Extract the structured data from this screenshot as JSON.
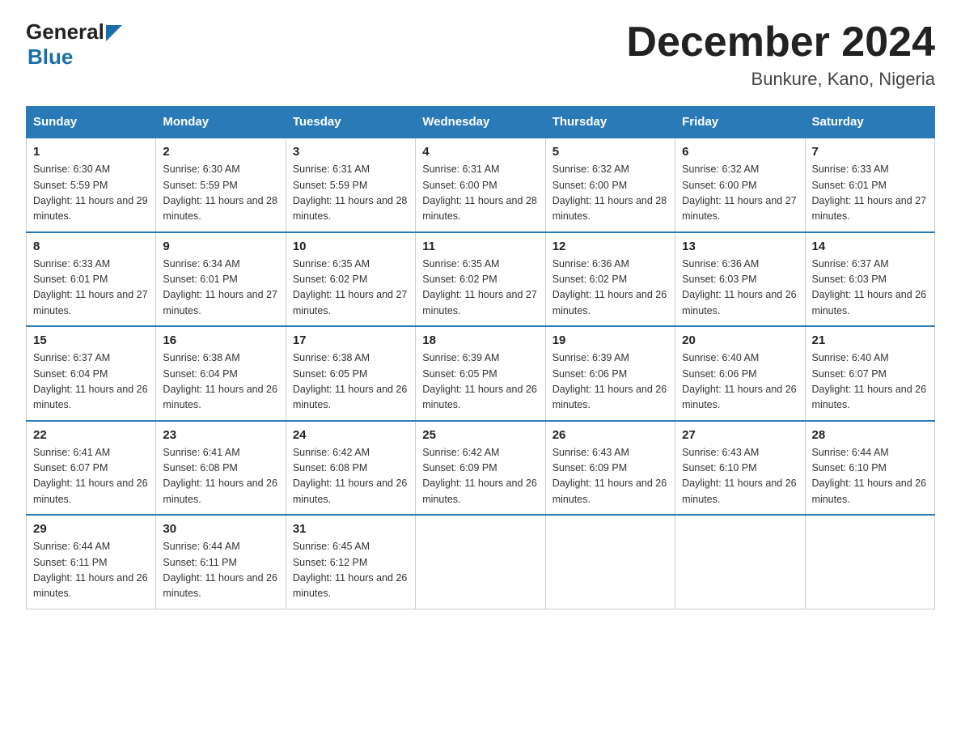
{
  "logo": {
    "text_general": "General",
    "text_blue": "Blue"
  },
  "header": {
    "month_title": "December 2024",
    "location": "Bunkure, Kano, Nigeria"
  },
  "weekdays": [
    "Sunday",
    "Monday",
    "Tuesday",
    "Wednesday",
    "Thursday",
    "Friday",
    "Saturday"
  ],
  "weeks": [
    [
      {
        "num": "1",
        "sunrise": "6:30 AM",
        "sunset": "5:59 PM",
        "daylight": "11 hours and 29 minutes."
      },
      {
        "num": "2",
        "sunrise": "6:30 AM",
        "sunset": "5:59 PM",
        "daylight": "11 hours and 28 minutes."
      },
      {
        "num": "3",
        "sunrise": "6:31 AM",
        "sunset": "5:59 PM",
        "daylight": "11 hours and 28 minutes."
      },
      {
        "num": "4",
        "sunrise": "6:31 AM",
        "sunset": "6:00 PM",
        "daylight": "11 hours and 28 minutes."
      },
      {
        "num": "5",
        "sunrise": "6:32 AM",
        "sunset": "6:00 PM",
        "daylight": "11 hours and 28 minutes."
      },
      {
        "num": "6",
        "sunrise": "6:32 AM",
        "sunset": "6:00 PM",
        "daylight": "11 hours and 27 minutes."
      },
      {
        "num": "7",
        "sunrise": "6:33 AM",
        "sunset": "6:01 PM",
        "daylight": "11 hours and 27 minutes."
      }
    ],
    [
      {
        "num": "8",
        "sunrise": "6:33 AM",
        "sunset": "6:01 PM",
        "daylight": "11 hours and 27 minutes."
      },
      {
        "num": "9",
        "sunrise": "6:34 AM",
        "sunset": "6:01 PM",
        "daylight": "11 hours and 27 minutes."
      },
      {
        "num": "10",
        "sunrise": "6:35 AM",
        "sunset": "6:02 PM",
        "daylight": "11 hours and 27 minutes."
      },
      {
        "num": "11",
        "sunrise": "6:35 AM",
        "sunset": "6:02 PM",
        "daylight": "11 hours and 27 minutes."
      },
      {
        "num": "12",
        "sunrise": "6:36 AM",
        "sunset": "6:02 PM",
        "daylight": "11 hours and 26 minutes."
      },
      {
        "num": "13",
        "sunrise": "6:36 AM",
        "sunset": "6:03 PM",
        "daylight": "11 hours and 26 minutes."
      },
      {
        "num": "14",
        "sunrise": "6:37 AM",
        "sunset": "6:03 PM",
        "daylight": "11 hours and 26 minutes."
      }
    ],
    [
      {
        "num": "15",
        "sunrise": "6:37 AM",
        "sunset": "6:04 PM",
        "daylight": "11 hours and 26 minutes."
      },
      {
        "num": "16",
        "sunrise": "6:38 AM",
        "sunset": "6:04 PM",
        "daylight": "11 hours and 26 minutes."
      },
      {
        "num": "17",
        "sunrise": "6:38 AM",
        "sunset": "6:05 PM",
        "daylight": "11 hours and 26 minutes."
      },
      {
        "num": "18",
        "sunrise": "6:39 AM",
        "sunset": "6:05 PM",
        "daylight": "11 hours and 26 minutes."
      },
      {
        "num": "19",
        "sunrise": "6:39 AM",
        "sunset": "6:06 PM",
        "daylight": "11 hours and 26 minutes."
      },
      {
        "num": "20",
        "sunrise": "6:40 AM",
        "sunset": "6:06 PM",
        "daylight": "11 hours and 26 minutes."
      },
      {
        "num": "21",
        "sunrise": "6:40 AM",
        "sunset": "6:07 PM",
        "daylight": "11 hours and 26 minutes."
      }
    ],
    [
      {
        "num": "22",
        "sunrise": "6:41 AM",
        "sunset": "6:07 PM",
        "daylight": "11 hours and 26 minutes."
      },
      {
        "num": "23",
        "sunrise": "6:41 AM",
        "sunset": "6:08 PM",
        "daylight": "11 hours and 26 minutes."
      },
      {
        "num": "24",
        "sunrise": "6:42 AM",
        "sunset": "6:08 PM",
        "daylight": "11 hours and 26 minutes."
      },
      {
        "num": "25",
        "sunrise": "6:42 AM",
        "sunset": "6:09 PM",
        "daylight": "11 hours and 26 minutes."
      },
      {
        "num": "26",
        "sunrise": "6:43 AM",
        "sunset": "6:09 PM",
        "daylight": "11 hours and 26 minutes."
      },
      {
        "num": "27",
        "sunrise": "6:43 AM",
        "sunset": "6:10 PM",
        "daylight": "11 hours and 26 minutes."
      },
      {
        "num": "28",
        "sunrise": "6:44 AM",
        "sunset": "6:10 PM",
        "daylight": "11 hours and 26 minutes."
      }
    ],
    [
      {
        "num": "29",
        "sunrise": "6:44 AM",
        "sunset": "6:11 PM",
        "daylight": "11 hours and 26 minutes."
      },
      {
        "num": "30",
        "sunrise": "6:44 AM",
        "sunset": "6:11 PM",
        "daylight": "11 hours and 26 minutes."
      },
      {
        "num": "31",
        "sunrise": "6:45 AM",
        "sunset": "6:12 PM",
        "daylight": "11 hours and 26 minutes."
      },
      null,
      null,
      null,
      null
    ]
  ]
}
